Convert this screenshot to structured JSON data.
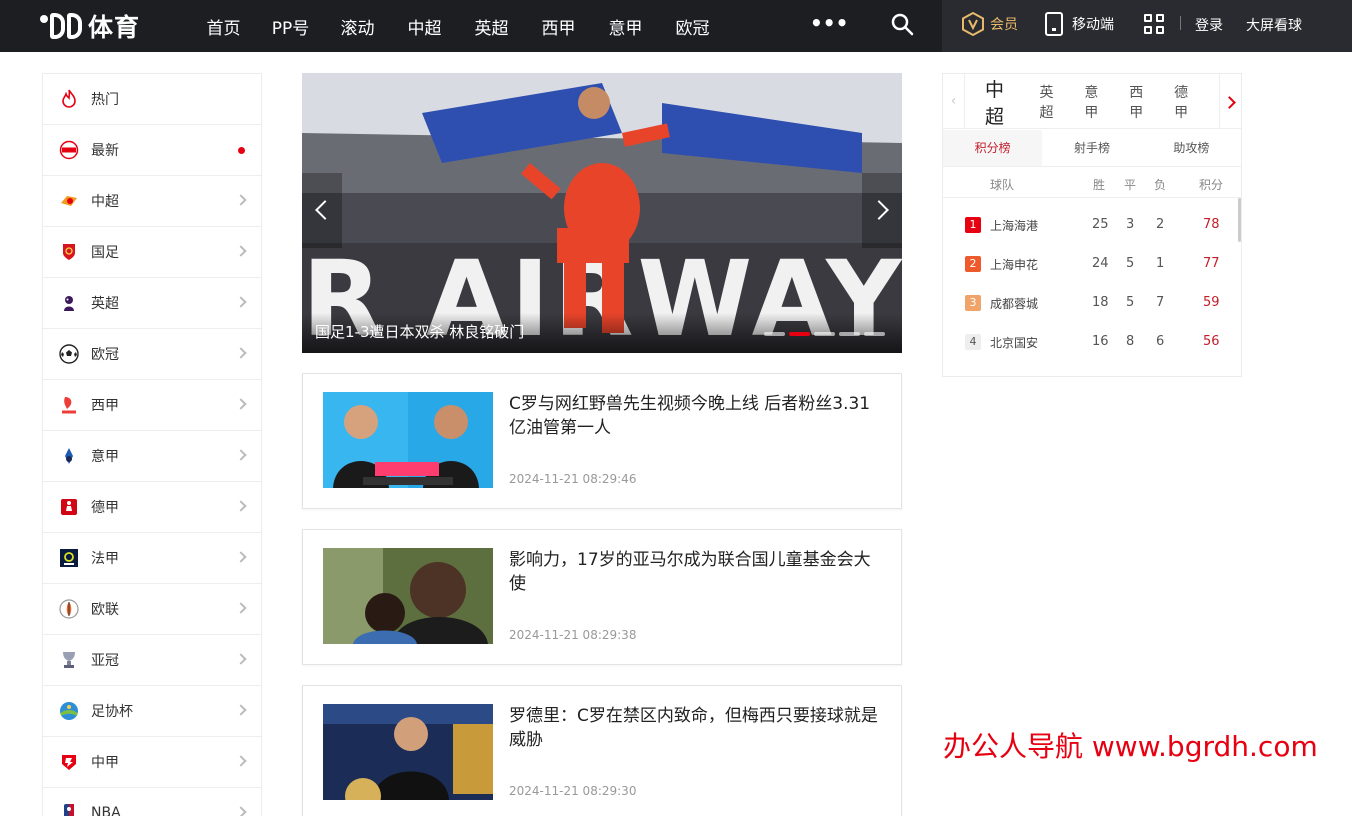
{
  "header": {
    "logo_text": "体育",
    "nav": [
      "首页",
      "PP号",
      "滚动",
      "中超",
      "英超",
      "西甲",
      "意甲",
      "欧冠"
    ],
    "more": "•••",
    "vip_label": "会员",
    "mobile_label": "移动端",
    "login_label": "登录",
    "bigscreen_label": "大屏看球"
  },
  "sidebar": {
    "items": [
      {
        "label": "热门",
        "icon": "flame-icon"
      },
      {
        "label": "最新",
        "icon": "new-badge-icon",
        "dot": true
      },
      {
        "label": "中超",
        "icon": "csl-logo-icon"
      },
      {
        "label": "国足",
        "icon": "china-national-team-icon"
      },
      {
        "label": "英超",
        "icon": "premier-league-icon"
      },
      {
        "label": "欧冠",
        "icon": "champions-league-ball-icon"
      },
      {
        "label": "西甲",
        "icon": "laliga-icon"
      },
      {
        "label": "意甲",
        "icon": "serie-a-icon"
      },
      {
        "label": "德甲",
        "icon": "bundesliga-icon"
      },
      {
        "label": "法甲",
        "icon": "ligue1-icon"
      },
      {
        "label": "欧联",
        "icon": "europa-league-icon"
      },
      {
        "label": "亚冠",
        "icon": "afc-trophy-icon"
      },
      {
        "label": "足协杯",
        "icon": "fa-cup-icon"
      },
      {
        "label": "中甲",
        "icon": "china-league-one-icon"
      },
      {
        "label": "NBA",
        "icon": "nba-icon"
      }
    ],
    "live_dot_color": "#e60012"
  },
  "carousel": {
    "caption": "国足1-3遭日本双杀 林良铭破门",
    "slide_count": 5,
    "active_slide": 2
  },
  "news": [
    {
      "title": "C罗与网红野兽先生视频今晚上线 后者粉丝3.31亿油管第一人",
      "time": "2024-11-21 08:29:46"
    },
    {
      "title": "影响力，17岁的亚马尔成为联合国儿童基金会大使",
      "time": "2024-11-21 08:29:38"
    },
    {
      "title": "罗德里：C罗在禁区内致命，但梅西只要接球就是威胁",
      "time": "2024-11-21 08:29:30"
    }
  ],
  "standings": {
    "prev": "‹",
    "leagues": [
      "中超",
      "英超",
      "意甲",
      "西甲",
      "德甲"
    ],
    "active_league": "中超",
    "tabs": [
      "积分榜",
      "射手榜",
      "助攻榜"
    ],
    "active_tab": "积分榜",
    "columns": [
      "球队",
      "胜",
      "平",
      "负",
      "积分"
    ],
    "rows": [
      {
        "rank": "1",
        "team": "上海海港",
        "w": "25",
        "d": "3",
        "l": "2",
        "pts": "78",
        "badge_color": "#e60012"
      },
      {
        "rank": "2",
        "team": "上海申花",
        "w": "24",
        "d": "5",
        "l": "1",
        "pts": "77",
        "badge_color": "#ee5a2b"
      },
      {
        "rank": "3",
        "team": "成都蓉城",
        "w": "18",
        "d": "5",
        "l": "7",
        "pts": "59",
        "badge_color": "#f0a46a"
      },
      {
        "rank": "4",
        "team": "北京国安",
        "w": "16",
        "d": "8",
        "l": "6",
        "pts": "56",
        "badge_color": "#eeeeee"
      }
    ]
  },
  "watermark": "办公人导航 www.bgrdh.com",
  "colors": {
    "accent": "#e60012",
    "header_bg": "#1d1e22",
    "vip_gold": "#e8b96a"
  }
}
